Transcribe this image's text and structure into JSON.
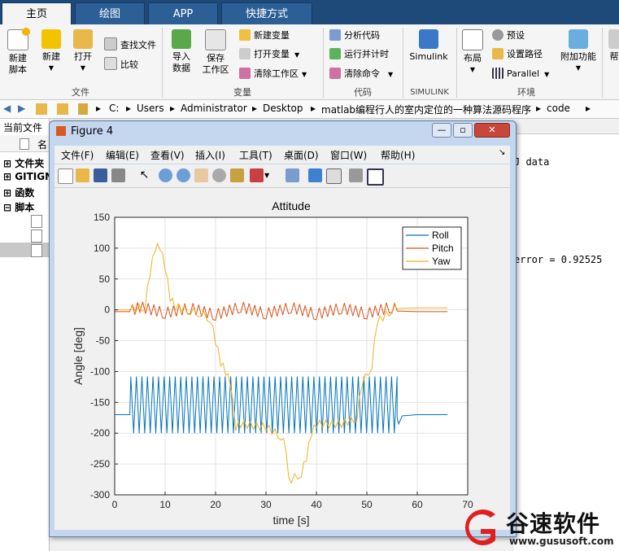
{
  "tabs": [
    {
      "label": "主页",
      "active": true
    },
    {
      "label": "绘图",
      "active": false
    },
    {
      "label": "APP",
      "active": false
    },
    {
      "label": "快捷方式",
      "active": false
    }
  ],
  "ribbon": {
    "file": {
      "new_script": "新建\n脚本",
      "new": "新建",
      "open": "打开",
      "find_files": "查找文件",
      "compare": "比较",
      "group": "文件"
    },
    "variable": {
      "import": "导入\n数据",
      "save_ws": "保存\n工作区",
      "new_var": "新建变量",
      "open_var": "打开变量",
      "clear_ws": "清除工作区",
      "group": "变量"
    },
    "code": {
      "analyze": "分析代码",
      "run_time": "运行并计时",
      "clear_cmd": "清除命令",
      "group": "代码"
    },
    "simulink": {
      "btn": "Simulink",
      "group": "SIMULINK"
    },
    "env": {
      "layout": "布局",
      "prefs": "预设",
      "set_path": "设置路径",
      "parallel": "Parallel",
      "addons": "附加功能",
      "help": "帮",
      "group": "环境"
    }
  },
  "address": {
    "parts": [
      "C:",
      "Users",
      "Administrator",
      "Desktop",
      "matlab编程行人的室内定位的一种算法源码程序",
      "code"
    ]
  },
  "leftpanel": {
    "header": "当前文件",
    "col": "名",
    "items": [
      "文件夹",
      "GITIGN",
      "函数",
      "脚本"
    ]
  },
  "cmd": {
    "line1": "J data",
    "line2": "error = 0.92525"
  },
  "figure": {
    "title": "Figure 4",
    "menus": [
      "文件(F)",
      "编辑(E)",
      "查看(V)",
      "插入(I)",
      "工具(T)",
      "桌面(D)",
      "窗口(W)",
      "帮助(H)"
    ]
  },
  "chart_data": {
    "type": "line",
    "title": "Attitude",
    "xlabel": "time [s]",
    "ylabel": "Angle [deg]",
    "xlim": [
      0,
      70
    ],
    "ylim": [
      -300,
      150
    ],
    "xticks": [
      0,
      10,
      20,
      30,
      40,
      50,
      60,
      70
    ],
    "yticks": [
      150,
      100,
      50,
      0,
      -50,
      -100,
      -150,
      -200,
      -250,
      -300
    ],
    "grid": true,
    "legend_position": "top-right",
    "series": [
      {
        "name": "Roll",
        "color": "#0072bd",
        "x": [
          0,
          3,
          3.2,
          56,
          56.3,
          57,
          60,
          66
        ],
        "y": [
          -170,
          -170,
          -175,
          -175,
          -185,
          -172,
          -170,
          -170
        ],
        "osc_start": 3.2,
        "osc_end": 56,
        "osc_period": 1.1,
        "osc_high": -108,
        "osc_low": -200
      },
      {
        "name": "Pitch",
        "color": "#d95319",
        "x": [
          0,
          3,
          5,
          10,
          15,
          20,
          25,
          30,
          35,
          40,
          45,
          50,
          55,
          56,
          60,
          66
        ],
        "y": [
          -3,
          -3,
          5,
          -5,
          3,
          -8,
          5,
          -6,
          4,
          -7,
          3,
          -6,
          5,
          -2,
          -3,
          -3
        ]
      },
      {
        "name": "Yaw",
        "color": "#edb120",
        "x": [
          0,
          3,
          6,
          7,
          8,
          9,
          10,
          11,
          12,
          15,
          17,
          19,
          20,
          21,
          22,
          23,
          24,
          25,
          30,
          33,
          34,
          34.5,
          35,
          37,
          38,
          39,
          40,
          45,
          48,
          49,
          51,
          52,
          55,
          56,
          60,
          66
        ],
        "y": [
          0,
          0,
          5,
          60,
          100,
          103,
          70,
          20,
          5,
          -2,
          -5,
          -15,
          -50,
          -85,
          -100,
          -120,
          -190,
          -185,
          -190,
          -205,
          -225,
          -265,
          -275,
          -265,
          -240,
          -200,
          -185,
          -185,
          -175,
          -120,
          -90,
          -20,
          0,
          2,
          3,
          3
        ]
      }
    ]
  },
  "watermark": {
    "cn": "谷速软件",
    "url": "www.gususoft.com"
  }
}
